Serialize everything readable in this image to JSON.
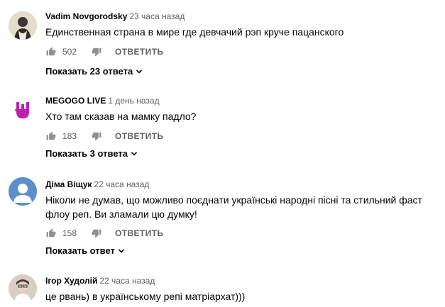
{
  "comments": [
    {
      "author": "Vadim Novgorodsky",
      "time": "23 часа назад",
      "text": "Единственная страна в мире где девчачий рэп круче пацанского",
      "likes": "502",
      "reply_label": "ОТВЕТИТЬ",
      "replies_label": "Показать 23 ответа",
      "avatar_icon": "photo-avatar",
      "avatar_color": "#dcd4c2"
    },
    {
      "author": "MEGOGO LIVE",
      "time": "1 день назад",
      "text": "Хто там сказав на мамку падло?",
      "likes": "183",
      "reply_label": "ОТВЕТИТЬ",
      "replies_label": "Показать 3 ответа",
      "avatar_icon": "rock-hand-logo",
      "avatar_color": "#c21fb0"
    },
    {
      "author": "Діма Віщук",
      "time": "22 часа назад",
      "text": "Ніколи не думав, що можливо поєднати українські народні пісні та стильний фаст флоу реп. Ви зламали цю думку!",
      "likes": "158",
      "reply_label": "ОТВЕТИТЬ",
      "replies_label": "Показать ответ",
      "avatar_icon": "default-user-avatar",
      "avatar_color": "#5b8fc9"
    },
    {
      "author": "Ігор Худолій",
      "time": "22 часа назад",
      "text": "це рвань) в українському репі матріархат)))",
      "avatar_icon": "photo-avatar",
      "avatar_color": "#cfc8bd"
    }
  ]
}
